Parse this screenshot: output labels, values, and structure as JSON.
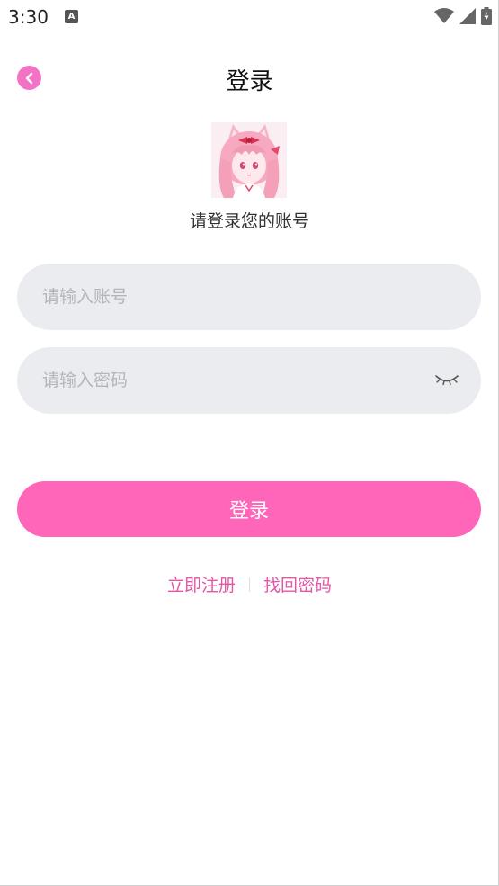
{
  "status_bar": {
    "time": "3:30",
    "app_icon": "A"
  },
  "header": {
    "title": "登录"
  },
  "profile": {
    "subtitle": "请登录您的账号"
  },
  "form": {
    "account_placeholder": "请输入账号",
    "account_value": "",
    "password_placeholder": "请输入密码",
    "password_value": ""
  },
  "actions": {
    "login_label": "登录",
    "register_label": "立即注册",
    "recover_label": "找回密码"
  },
  "icons": {
    "back": "chevron-left-icon",
    "password_toggle": "eye-closed-icon",
    "wifi": "wifi-icon",
    "signal": "signal-icon",
    "battery": "battery-icon"
  },
  "colors": {
    "accent": "#ff66b9",
    "link": "#e455a5",
    "back_button": "#f472c6",
    "field_bg": "#ebecf0"
  }
}
